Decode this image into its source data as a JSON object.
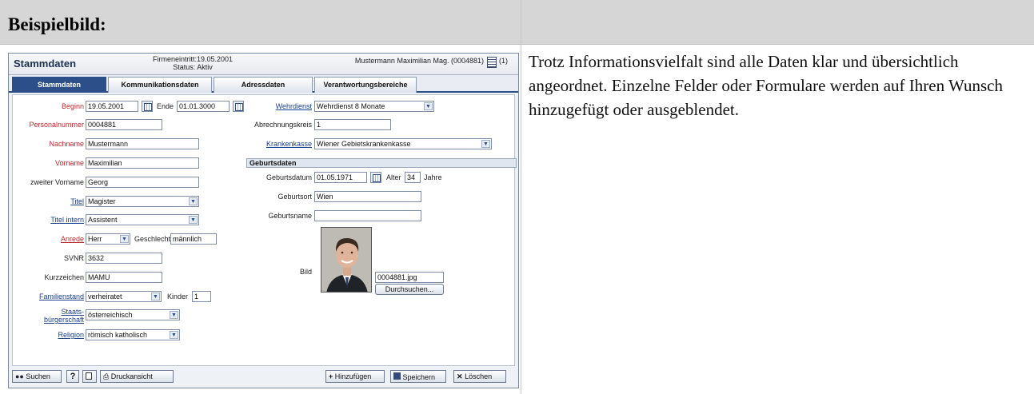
{
  "doc": {
    "heading": "Beispielbild:",
    "description": "Trotz Informationsvielfalt sind alle Daten klar und übersichtlich angeordnet. Einzelne Felder oder Formulare werden auf Ihren Wunsch hinzugefügt oder ausgeblendet."
  },
  "app": {
    "title": "Stammdaten",
    "entry_date": "Firmeneintritt:19.05.2001",
    "status": "Status: Aktiv",
    "user": "Mustermann Maximilian Mag. (0004881)",
    "count": "(1)",
    "tabs": [
      "Stammdaten",
      "Kommunikationsdaten",
      "Adressdaten",
      "Verantwortungsbereiche"
    ],
    "active_tab": "Stammdaten"
  },
  "left": {
    "beginn_label": "Beginn",
    "beginn": "19.05.2001",
    "ende_label": "Ende",
    "ende": "01.01.3000",
    "personalnummer_label": "Personalnummer",
    "personalnummer": "0004881",
    "nachname_label": "Nachname",
    "nachname": "Mustermann",
    "vorname_label": "Vorname",
    "vorname": "Maximilian",
    "zweiter_vorname_label": "zweiter Vorname",
    "zweiter_vorname": "Georg",
    "titel_label": "Titel",
    "titel": "Magister",
    "titel_intern_label": "Titel intern",
    "titel_intern": "Assistent",
    "anrede_label": "Anrede",
    "anrede": "Herr",
    "geschlecht_label": "Geschlecht",
    "geschlecht": "männlich",
    "svnr_label": "SVNR",
    "svnr": "3632",
    "kurzzeichen_label": "Kurzzeichen",
    "kurzzeichen": "MAMU",
    "familienstand_label": "Familienstand",
    "familienstand": "verheiratet",
    "kinder_label": "Kinder",
    "kinder": "1",
    "staats_label1": "Staats-",
    "staats_label2": "bürgerschaft",
    "staats": "österreichisch",
    "religion_label": "Religion",
    "religion": "römisch katholisch"
  },
  "right": {
    "wehrdienst_label": "Wehrdienst",
    "wehrdienst": "Wehrdienst 8 Monate",
    "abrechnungskreis_label": "Abrechnungskreis",
    "abrechnungskreis": "1",
    "krankenkasse_label": "Krankenkasse",
    "krankenkasse": "Wiener Gebietskrankenkasse",
    "geburtsdaten_section": "Geburtsdaten",
    "geburtsdatum_label": "Geburtsdatum",
    "geburtsdatum": "01.05.1971",
    "alter_label": "Alter",
    "alter": "34",
    "jahre_label": "Jahre",
    "geburtsort_label": "Geburtsort",
    "geburtsort": "Wien",
    "geburtsname_label": "Geburtsname",
    "geburtsname": "",
    "bild_label": "Bild",
    "bild_file": "0004881.jpg",
    "browse_label": "Durchsuchen..."
  },
  "buttons": {
    "suchen": "Suchen",
    "help": "?",
    "druckansicht": "Druckansicht",
    "hinzufuegen": "Hinzufügen",
    "speichern": "Speichern",
    "loeschen": "Löschen"
  },
  "colors": {
    "accent": "#2c4f8a",
    "required_label": "#c0282d",
    "link_label": "#1a3f8c"
  }
}
